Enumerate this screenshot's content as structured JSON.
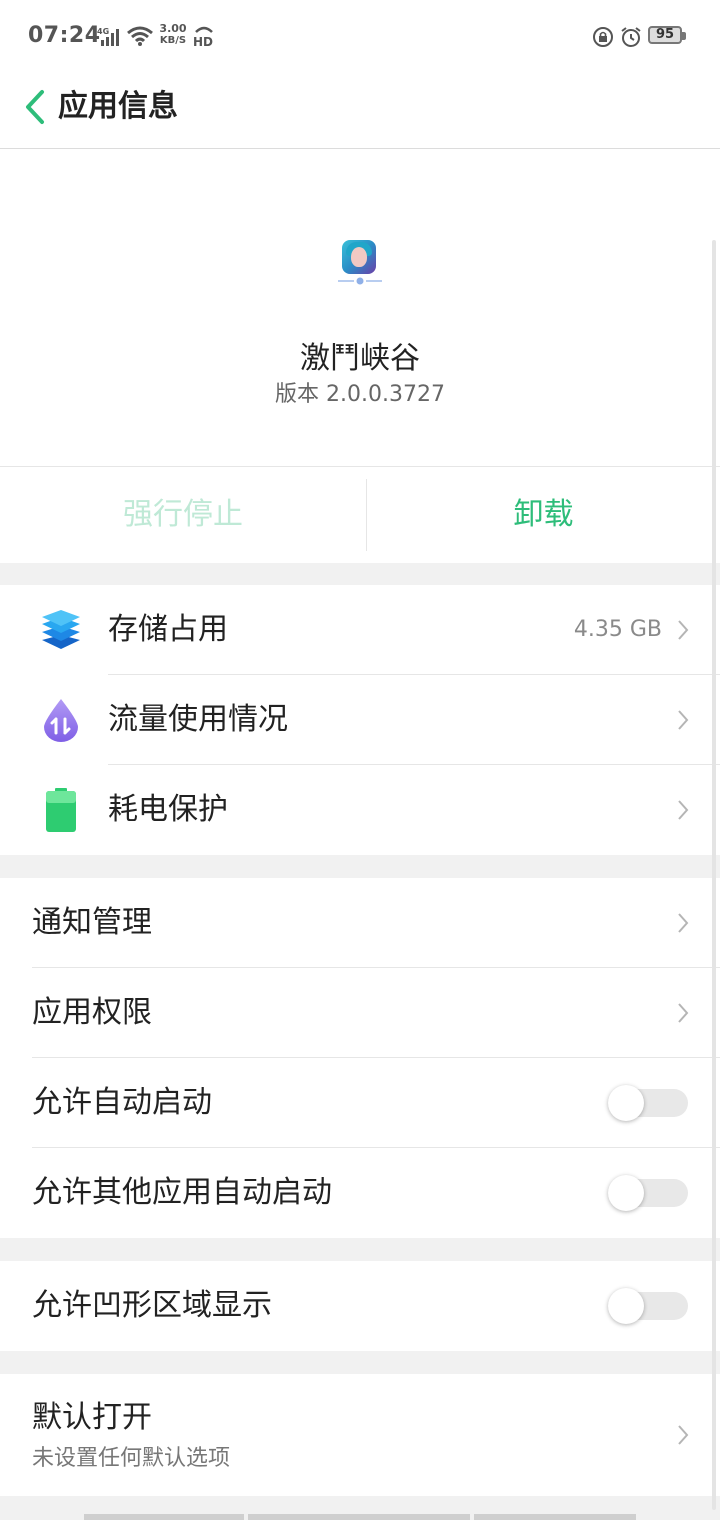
{
  "status_bar": {
    "time": "07:24",
    "network": "4G",
    "speed_value": "3.00",
    "speed_unit": "KB/S",
    "hd": "HD",
    "battery": "95"
  },
  "header": {
    "title": "应用信息"
  },
  "app": {
    "name": "激鬥峡谷",
    "version": "版本 2.0.0.3727"
  },
  "actions": {
    "force_stop": "强行停止",
    "uninstall": "卸载"
  },
  "group1": {
    "storage": {
      "label": "存储占用",
      "value": "4.35 GB"
    },
    "data_usage": {
      "label": "流量使用情况"
    },
    "battery": {
      "label": "耗电保护"
    }
  },
  "group2": {
    "notifications": {
      "label": "通知管理"
    },
    "permissions": {
      "label": "应用权限"
    },
    "auto_start": {
      "label": "允许自动启动",
      "enabled": false
    },
    "other_auto_start": {
      "label": "允许其他应用自动启动",
      "enabled": false
    }
  },
  "group3": {
    "notch": {
      "label": "允许凹形区域显示",
      "enabled": false
    }
  },
  "group4": {
    "default_open": {
      "label": "默认打开",
      "sub": "未设置任何默认选项"
    }
  },
  "colors": {
    "accent": "#2ebd7a",
    "accent_disabled": "#bfe9d6",
    "background": "#f1f1f1"
  }
}
